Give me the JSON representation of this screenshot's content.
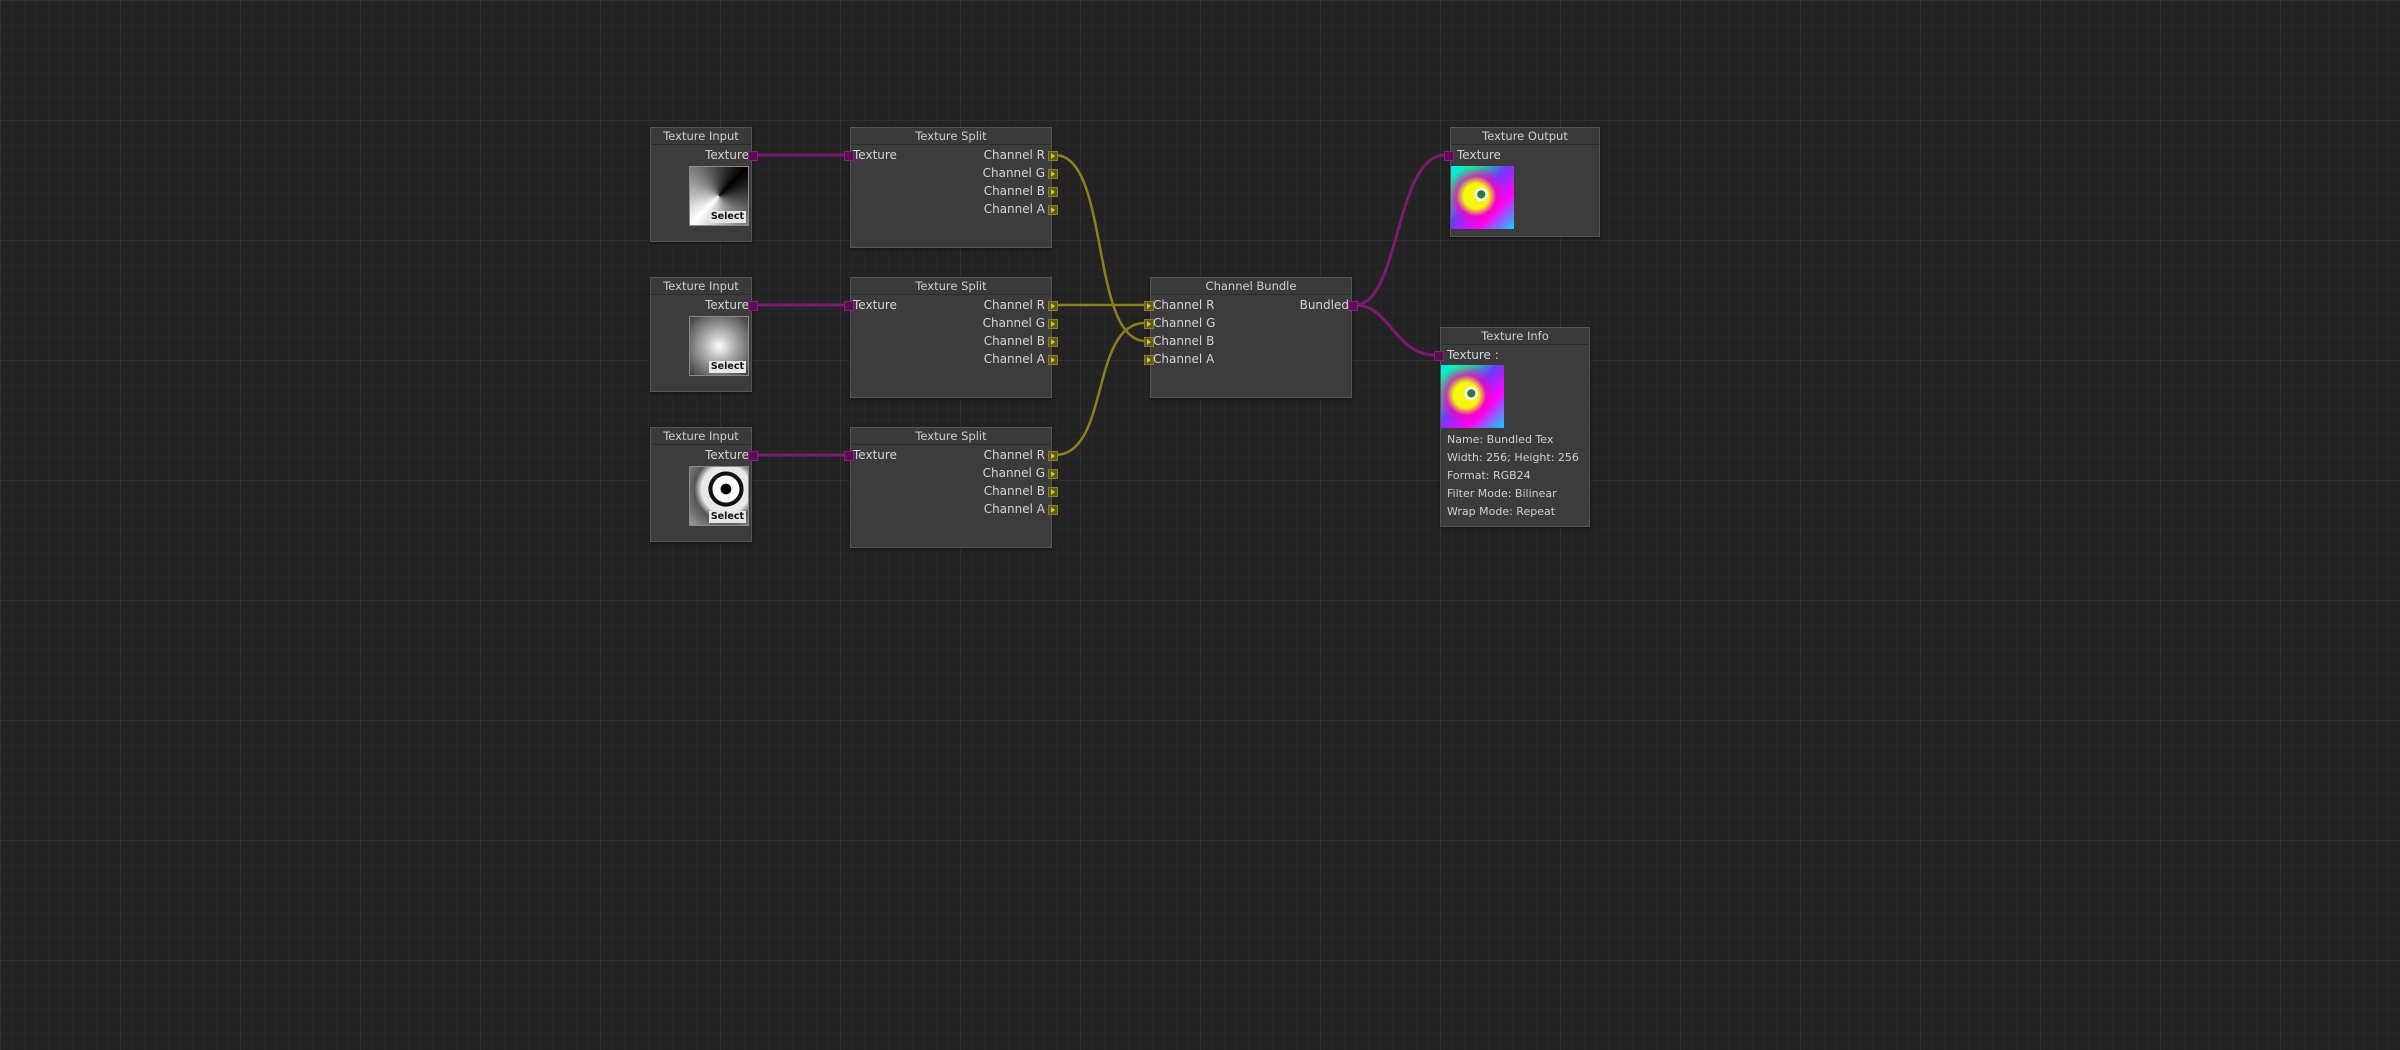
{
  "colors": {
    "background": "#232323",
    "texture_wire": "#7a1a6f",
    "channel_wire": "#8d7f1e",
    "node_body": "#3c3c3c",
    "node_border": "#555555"
  },
  "nodes": {
    "input1": {
      "title": "Texture Input",
      "output": "Texture",
      "select": "Select"
    },
    "input2": {
      "title": "Texture Input",
      "output": "Texture",
      "select": "Select"
    },
    "input3": {
      "title": "Texture Input",
      "output": "Texture",
      "select": "Select"
    },
    "split1": {
      "title": "Texture Split",
      "input": "Texture",
      "outputs": [
        "Channel R",
        "Channel G",
        "Channel B",
        "Channel A"
      ]
    },
    "split2": {
      "title": "Texture Split",
      "input": "Texture",
      "outputs": [
        "Channel R",
        "Channel G",
        "Channel B",
        "Channel A"
      ]
    },
    "split3": {
      "title": "Texture Split",
      "input": "Texture",
      "outputs": [
        "Channel R",
        "Channel G",
        "Channel B",
        "Channel A"
      ]
    },
    "bundle": {
      "title": "Channel Bundle",
      "inputs": [
        "Channel R",
        "Channel G",
        "Channel B",
        "Channel A"
      ],
      "output": "Bundled"
    },
    "output": {
      "title": "Texture Output",
      "input": "Texture"
    },
    "info": {
      "title": "Texture Info",
      "input": "Texture :",
      "lines": [
        "Name: Bundled Tex",
        "Width: 256; Height: 256",
        "Format: RGB24",
        "Filter Mode: Bilinear",
        "Wrap Mode: Repeat"
      ]
    }
  }
}
